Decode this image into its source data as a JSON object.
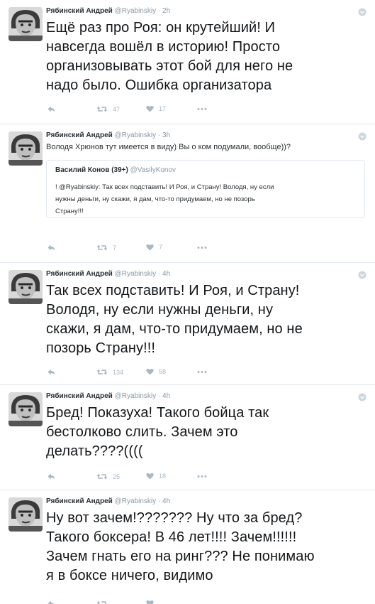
{
  "tweets": [
    {
      "name": "Рябинский Андрей",
      "handle": "@Ryabinskiy",
      "sep": "·",
      "time": "2h",
      "lines": [
        "Ещё раз про Роя: он крутейший! И",
        "навсегда вошёл в историю! Просто",
        "организовывать этот бой для него не",
        "надо было. Ошибка организатора"
      ],
      "retweets": "47",
      "likes": "17"
    },
    {
      "name": "Рябинский Андрей",
      "handle": "@Ryabinskiy",
      "sep": "·",
      "time": "3h",
      "text": "Володя Хрюнов тут имеется в виду) Вы о ком подумали, вообще))?",
      "quote": {
        "name": "Василий Конов (39+)",
        "handle": "@VasilyKonov",
        "lines": [
          "! @Ryabinskiy: Так всех подставить! И Роя, и Страну! Володя, ну если",
          "нужны деньги, ну скажи, я дам, что-то придумаем, но не позорь",
          "Страну!!!"
        ]
      },
      "retweets": "7",
      "likes": "7"
    },
    {
      "name": "Рябинский Андрей",
      "handle": "@Ryabinskiy",
      "sep": "·",
      "time": "4h",
      "lines": [
        "Так всех подставить! И Роя, и Страну!",
        "Володя, ну если нужны деньги, ну",
        "скажи, я дам, что-то придумаем, но не",
        "позорь Страну!!!"
      ],
      "retweets": "134",
      "likes": "58"
    },
    {
      "name": "Рябинский Андрей",
      "handle": "@Ryabinskiy",
      "sep": "·",
      "time": "4h",
      "lines": [
        "Бред! Показуха! Такого бойца так",
        "бестолково слить. Зачем это",
        "делать????(((("
      ],
      "retweets": "25",
      "likes": "18"
    },
    {
      "name": "Рябинский Андрей",
      "handle": "@Ryabinskiy",
      "sep": "·",
      "time": "4h",
      "lines": [
        "Ну вот зачем!??????? Ну что за бред?",
        "Такого боксера! В 46 лет!!!! Зачем!!!!!!",
        "Зачем гнать его на ринг??? Не понимаю",
        "я в боксе ничего, видимо"
      ],
      "retweets": "",
      "likes": ""
    }
  ],
  "icons": {
    "reply": "reply-arrow-icon",
    "retweet": "retweet-icon",
    "like": "heart-icon",
    "more": "more-dots-icon",
    "menu": "chevron-down-icon"
  },
  "colors": {
    "text": "#14171a",
    "muted": "#8899a6",
    "icon": "#aab8c2",
    "border": "#e1e8ed"
  }
}
